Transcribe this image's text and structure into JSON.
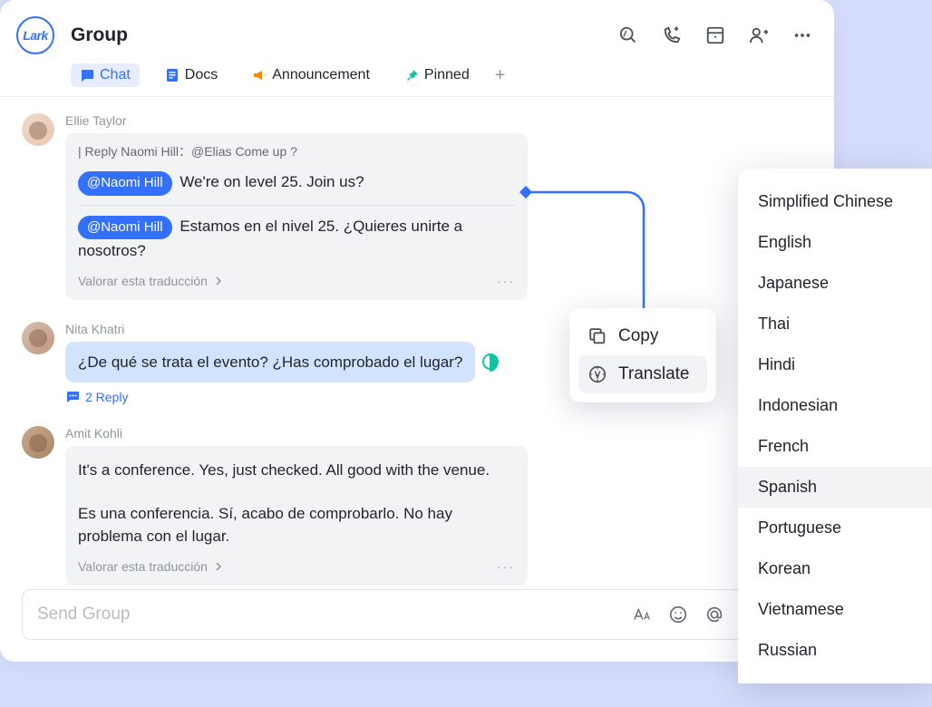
{
  "header": {
    "logo_text": "Lark",
    "title": "Group"
  },
  "tabs": {
    "chat": "Chat",
    "docs": "Docs",
    "announcement": "Announcement",
    "pinned": "Pinned"
  },
  "messages": {
    "m1": {
      "sender": "Ellie Taylor",
      "reply_ref": "| Reply Naomi Hill：@Elias Come up ?",
      "mention": "@Naomi Hill",
      "text_en": "We're on level 25. Join us?",
      "text_es": "Estamos en el nivel 25. ¿Quieres unirte a nosotros?",
      "rate_label": "Valorar esta traducción"
    },
    "m2": {
      "sender": "Nita Khatri",
      "text": "¿De qué se trata el evento? ¿Has comprobado el lugar?",
      "reply_count": "2 Reply"
    },
    "m3": {
      "sender": "Amit Kohli",
      "text_en": "It's a conference. Yes, just checked. All good with the venue.",
      "text_es": "Es una conferencia. Sí, acabo de comprobarlo. No hay problema con el lugar.",
      "rate_label": "Valorar esta traducción"
    }
  },
  "composer": {
    "placeholder": "Send Group"
  },
  "context_menu": {
    "copy": "Copy",
    "translate": "Translate"
  },
  "languages": [
    "Simplified Chinese",
    "English",
    "Japanese",
    "Thai",
    "Hindi",
    "Indonesian",
    "French",
    "Spanish",
    "Portuguese",
    "Korean",
    "Vietnamese",
    "Russian"
  ],
  "selected_language_index": 7
}
